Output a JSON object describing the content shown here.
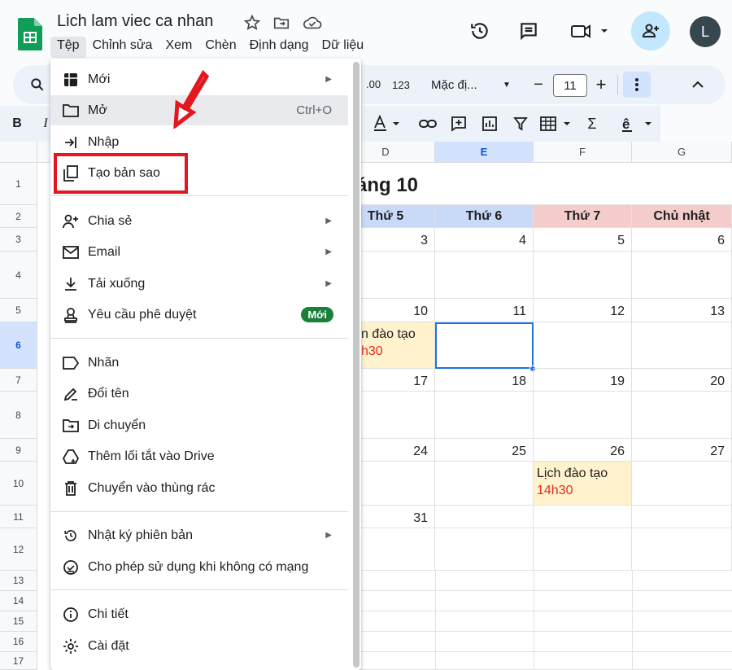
{
  "header": {
    "title": "Lich lam viec ca nhan",
    "avatar_letter": "L"
  },
  "menubar": {
    "items": [
      "Tệp",
      "Chỉnh sửa",
      "Xem",
      "Chèn",
      "Định dạng",
      "Dữ liệu"
    ]
  },
  "toolbar": {
    "format_num": "123",
    "font": "Mặc đị...",
    "font_size": "11",
    "minus": "−",
    "plus": "+",
    "bold": "B",
    "italic": "I"
  },
  "grid": {
    "columns": [
      "D",
      "E",
      "F",
      "G"
    ],
    "rows": [
      "1",
      "2",
      "3",
      "4",
      "5",
      "6",
      "7",
      "8",
      "9",
      "10",
      "11",
      "12",
      "13",
      "14",
      "15",
      "16",
      "17"
    ],
    "month_title": "áng 10",
    "day_headers": [
      "Thứ 5",
      "Thứ 6",
      "Thứ 7",
      "Chủ nhật"
    ],
    "week_numbers": [
      [
        "3",
        "4",
        "5",
        "6"
      ],
      [
        "10",
        "11",
        "12",
        "13"
      ],
      [
        "17",
        "18",
        "19",
        "20"
      ],
      [
        "24",
        "25",
        "26",
        "27"
      ],
      [
        "31",
        "",
        "",
        ""
      ]
    ],
    "events": [
      {
        "title": "n đào tạo",
        "time": "h30"
      },
      {
        "title": "Lịch đào tạo",
        "time": "14h30"
      }
    ]
  },
  "file_menu": {
    "items": [
      {
        "label": "Mới",
        "icon": "sheet-plus-icon",
        "arrow": "▶"
      },
      {
        "label": "Mở",
        "icon": "folder-icon",
        "shortcut": "Ctrl+O"
      },
      {
        "label": "Nhập",
        "icon": "import-icon"
      },
      {
        "label": "Tạo bản sao",
        "icon": "copy-icon"
      },
      {
        "label": "Chia sẻ",
        "icon": "person-add-icon",
        "arrow": "▶"
      },
      {
        "label": "Email",
        "icon": "mail-icon",
        "arrow": "▶"
      },
      {
        "label": "Tải xuống",
        "icon": "download-icon",
        "arrow": "▶"
      },
      {
        "label": "Yêu cầu phê duyệt",
        "icon": "approval-icon",
        "badge": "Mới"
      },
      {
        "label": "Nhãn",
        "icon": "label-icon"
      },
      {
        "label": "Đổi tên",
        "icon": "rename-icon"
      },
      {
        "label": "Di chuyển",
        "icon": "move-folder-icon"
      },
      {
        "label": "Thêm lối tắt vào Drive",
        "icon": "drive-shortcut-icon"
      },
      {
        "label": "Chuyển vào thùng rác",
        "icon": "trash-icon"
      },
      {
        "label": "Nhật ký phiên bản",
        "icon": "history-icon",
        "arrow": "▶"
      },
      {
        "label": "Cho phép sử dụng khi không có mạng",
        "icon": "offline-icon"
      },
      {
        "label": "Chi tiết",
        "icon": "info-icon"
      },
      {
        "label": "Cài đặt",
        "icon": "settings-icon"
      }
    ]
  },
  "colors": {
    "thu5_hdr": "#c9daf8",
    "thu6_hdr": "#c9daf8",
    "thu7_hdr": "#f4cccc",
    "cn_hdr": "#f4cccc",
    "event_bg": "#fff2cc",
    "event_time": "#e32d1b",
    "highlight": "#e4161f",
    "badge": "#188038"
  }
}
